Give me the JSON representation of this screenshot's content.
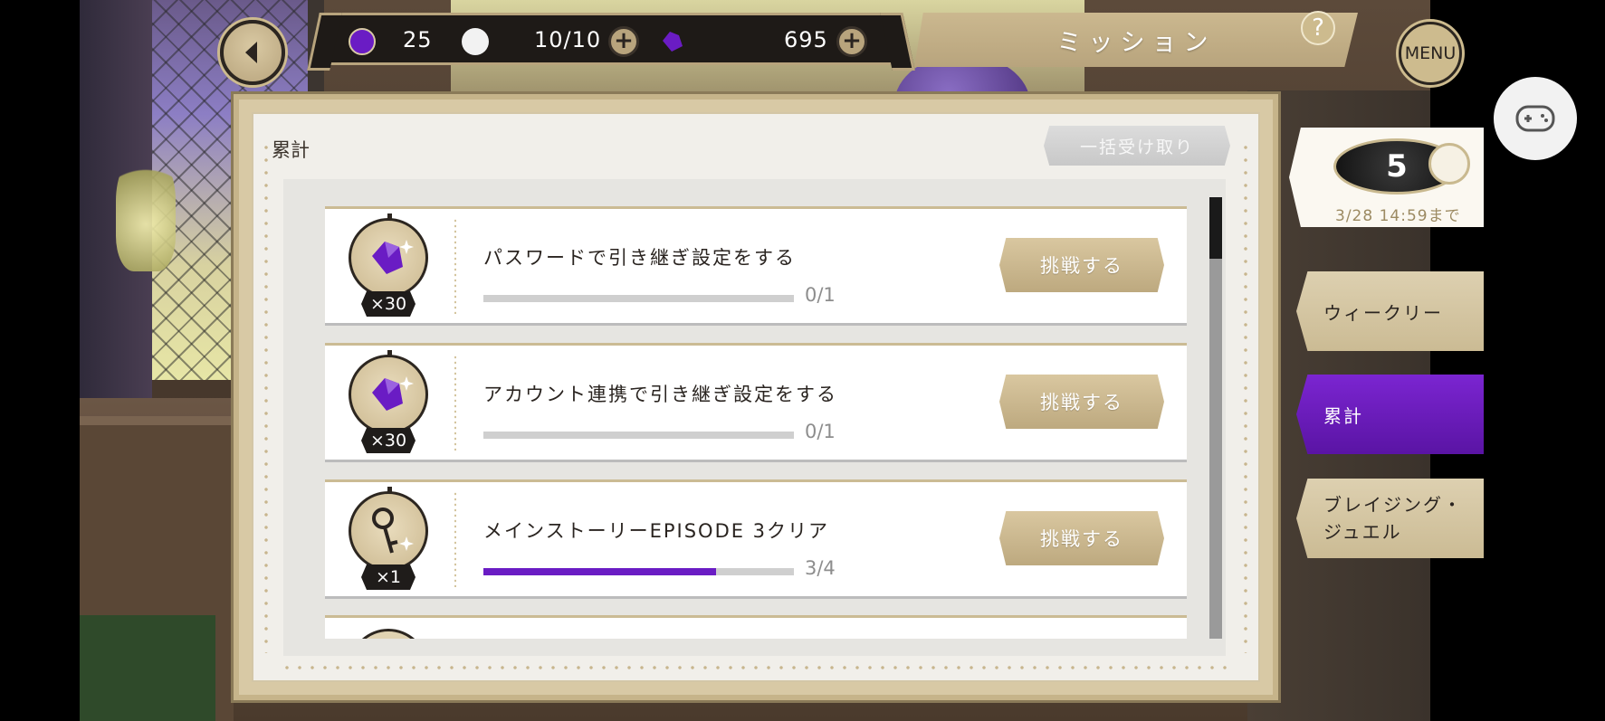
{
  "header": {
    "title": "ミッション",
    "help_label": "?",
    "menu_label": "MENU"
  },
  "resources": {
    "orb": {
      "value": "25",
      "color": "#6a1cc4"
    },
    "stamina": {
      "value": "10/10"
    },
    "gems": {
      "value": "695",
      "color": "#6a1cc4"
    }
  },
  "panel": {
    "heading": "累計",
    "claim_all_label": "一括受け取り",
    "scroll_position": 0.0
  },
  "missions": [
    {
      "title": "パスワードで引き継ぎ設定をする",
      "reward_icon": "purple-gem-icon",
      "reward_qty": "×30",
      "progress_text": "0/1",
      "progress": 0.0,
      "button": "挑戦する"
    },
    {
      "title": "アカウント連携で引き継ぎ設定をする",
      "reward_icon": "purple-gem-icon",
      "reward_qty": "×30",
      "progress_text": "0/1",
      "progress": 0.0,
      "button": "挑戦する"
    },
    {
      "title": "メインストーリーEPISODE 3クリア",
      "reward_icon": "key-icon",
      "reward_qty": "×1",
      "progress_text": "3/4",
      "progress": 0.75,
      "button": "挑戦する"
    }
  ],
  "side_tabs": {
    "event": {
      "logo_text": "5",
      "date": "3/28 14:59まで"
    },
    "weekly": "ウィークリー",
    "total": "累計",
    "blazing": "ブレイジング・ジュエル",
    "active_color": "#6a1cc4"
  }
}
